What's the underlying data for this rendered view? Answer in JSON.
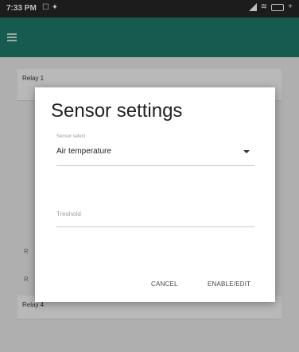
{
  "status_bar": {
    "time": "7:33 PM",
    "left_icons": "☐ ✦",
    "battery": "",
    "colors": {
      "bg": "#262626"
    }
  },
  "app_bar": {
    "menu_icon": "hamburger-menu-icon",
    "color": "#1f7b6c"
  },
  "cards": [
    {
      "label": "Relay 1"
    },
    {
      "label": "Relay 4"
    }
  ],
  "dialog": {
    "title": "Sensor settings",
    "sensor_select_label": "Sensor select",
    "sensor_select_value": "Air temperature",
    "threshold_placeholder": "Treshold",
    "cancel_label": "CANCEL",
    "enable_label": "ENABLE/EDIT"
  },
  "partial_labels": [
    "R",
    "R"
  ]
}
